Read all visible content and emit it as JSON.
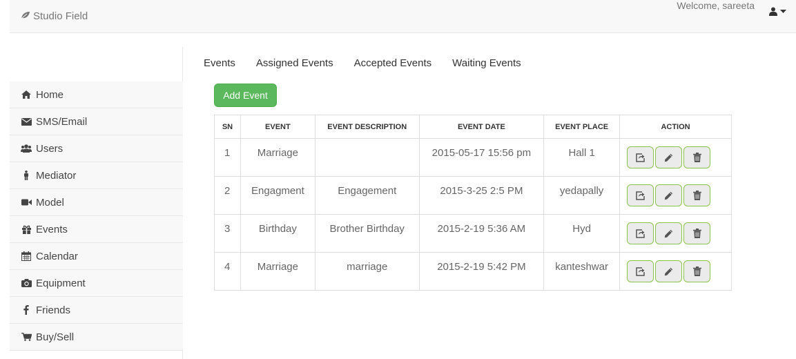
{
  "brand": {
    "name": "Studio Field",
    "icon": "leaf-icon"
  },
  "header": {
    "welcome": "Welcome, sareeta",
    "user_icon": "user-icon",
    "caret_icon": "caret-down-icon"
  },
  "sidebar": {
    "items": [
      {
        "label": "Home",
        "icon": "home-icon"
      },
      {
        "label": "SMS/Email",
        "icon": "envelope-icon"
      },
      {
        "label": "Users",
        "icon": "users-icon"
      },
      {
        "label": "Mediator",
        "icon": "male-icon"
      },
      {
        "label": "Model",
        "icon": "video-camera-icon"
      },
      {
        "label": "Events",
        "icon": "gift-icon"
      },
      {
        "label": "Calendar",
        "icon": "calendar-icon"
      },
      {
        "label": "Equipment",
        "icon": "camera-icon"
      },
      {
        "label": "Friends",
        "icon": "facebook-icon"
      },
      {
        "label": "Buy/Sell",
        "icon": "shopping-cart-icon"
      }
    ]
  },
  "tabs": [
    "Events",
    "Assigned Events",
    "Accepted Events",
    "Waiting Events"
  ],
  "add_button": "Add Event",
  "table": {
    "headers": [
      "SN",
      "EVENT",
      "EVENT DESCRIPTION",
      "EVENT DATE",
      "EVENT PLACE",
      "ACTION"
    ],
    "rows": [
      {
        "sn": "1",
        "event": "Marriage",
        "description": "",
        "date": "2015-05-17 15:56 pm",
        "place": "Hall 1"
      },
      {
        "sn": "2",
        "event": "Engagment",
        "description": "Engagement",
        "date": "2015-3-25 2:5 PM",
        "place": "yedapally"
      },
      {
        "sn": "3",
        "event": "Birthday",
        "description": "Brother Birthday",
        "date": "2015-2-19 5:36 AM",
        "place": "Hyd"
      },
      {
        "sn": "4",
        "event": "Marriage",
        "description": "marriage",
        "date": "2015-2-19 5:42 PM",
        "place": "kanteshwar"
      }
    ],
    "action_icons": [
      "share-icon",
      "pencil-icon",
      "trash-icon"
    ]
  },
  "colors": {
    "accent_green": "#5cb85c",
    "action_border": "#8bc34a",
    "navbar_bg": "#f8f8f8"
  }
}
